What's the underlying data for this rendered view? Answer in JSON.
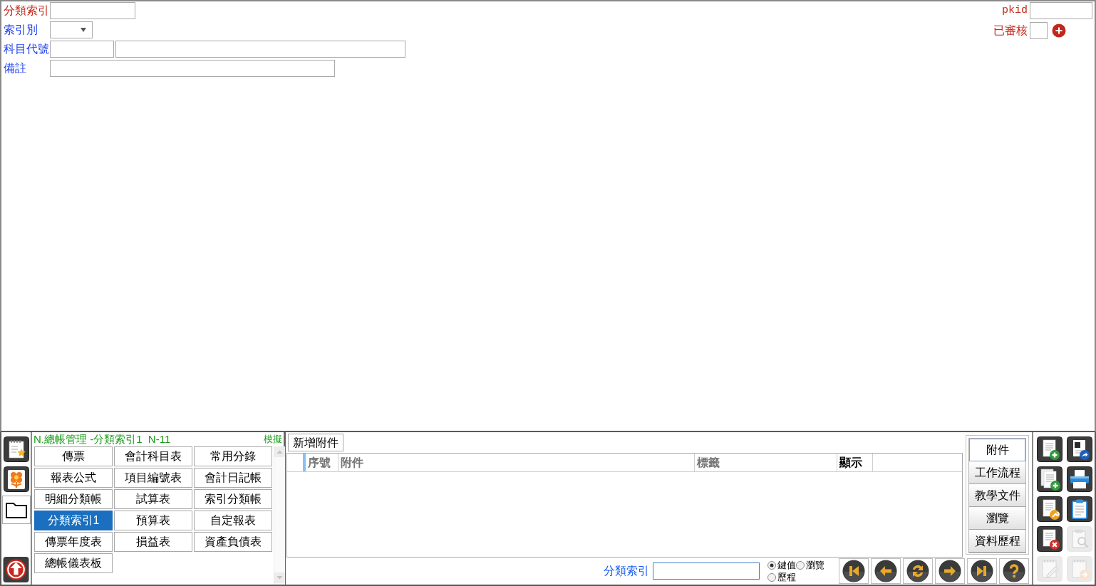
{
  "form": {
    "fields": [
      {
        "label": "分類索引",
        "kind": "short",
        "required": true
      },
      {
        "label": "索引別",
        "kind": "select",
        "required": false
      },
      {
        "label": "科目代號",
        "kind": "code",
        "required": false
      },
      {
        "label": "備註",
        "kind": "long",
        "required": false
      }
    ]
  },
  "record_info": {
    "pkid_label": "pkid",
    "approved": {
      "label": "已審核",
      "checked": false
    }
  },
  "side_tabs": [
    {
      "selected": false
    },
    {
      "selected": false
    },
    {
      "selected": true
    }
  ],
  "menu": {
    "title": "N.總帳管理 -分類索引1  N-11",
    "mode": "模擬",
    "items": [
      {
        "label": "傳票",
        "selected": false
      },
      {
        "label": "會計科目表",
        "selected": false
      },
      {
        "label": "常用分錄",
        "selected": false
      },
      {
        "label": "報表公式",
        "selected": false
      },
      {
        "label": "項目編號表",
        "selected": false
      },
      {
        "label": "會計日記帳",
        "selected": false
      },
      {
        "label": "明細分類帳",
        "selected": false
      },
      {
        "label": "試算表",
        "selected": false
      },
      {
        "label": "索引分類帳",
        "selected": false
      },
      {
        "label": "分類索引1",
        "selected": true
      },
      {
        "label": "預算表",
        "selected": false
      },
      {
        "label": "自定報表",
        "selected": false
      },
      {
        "label": "傳票年度表",
        "selected": false
      },
      {
        "label": "損益表",
        "selected": false
      },
      {
        "label": "資產負債表",
        "selected": false
      },
      {
        "label": "總帳儀表板",
        "selected": false
      }
    ]
  },
  "attachments": {
    "add_button": "新增附件",
    "columns": [
      {
        "label": "序號",
        "selected": true,
        "disabled": true
      },
      {
        "label": "附件",
        "selected": false,
        "disabled": true
      },
      {
        "label": "標籤",
        "selected": false,
        "disabled": true
      },
      {
        "label": "顯示",
        "selected": false,
        "disabled": false
      }
    ]
  },
  "side_panel": {
    "tabs": [
      {
        "label": "附件",
        "selected": true
      },
      {
        "label": "工作流程",
        "selected": false
      },
      {
        "label": "教學文件",
        "selected": false
      },
      {
        "label": "瀏覽",
        "selected": false
      },
      {
        "label": "資料歷程",
        "selected": false
      }
    ]
  },
  "search": {
    "label": "分類索引",
    "options": [
      {
        "label": "鍵值",
        "selected": true
      },
      {
        "label": "瀏覽",
        "selected": false
      },
      {
        "label": "歷程",
        "selected": false
      }
    ]
  },
  "toolbar": [
    {
      "disabled": false
    },
    {
      "disabled": false
    },
    {
      "disabled": false
    },
    {
      "disabled": false
    },
    {
      "disabled": false
    },
    {
      "disabled": false
    },
    {
      "disabled": false
    },
    {
      "disabled": true
    },
    {
      "disabled": true
    },
    {
      "disabled": true
    }
  ]
}
